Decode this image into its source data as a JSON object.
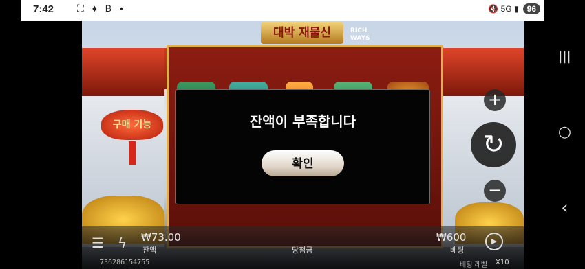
{
  "status_bar": {
    "time": "7:42",
    "left_icons": "⛶ ♦ B •",
    "right_icons": "🔇 5G ▮",
    "battery": "96"
  },
  "nav_bar": {
    "recents_icon": "|||",
    "home_icon": "○",
    "back_icon": "‹"
  },
  "game": {
    "title": "대박 재물신",
    "title_sub_line1": "RICH",
    "title_sub_line2": "WAYS",
    "buy_feature_label": "구매 기능",
    "controls": {
      "plus": "+",
      "spin": "↻",
      "minus": "−"
    },
    "bottom": {
      "menu_icon": "☰",
      "turbo_icon": "ϟ",
      "balance_value": "₩73.00",
      "balance_label": "잔액",
      "win_label": "당첨금",
      "bet_value": "₩600",
      "bet_label": "베팅",
      "autoplay_icon": "▶",
      "session_id": "736286154755",
      "bet_level_label": "베팅 레벨",
      "bet_level_value": "X10"
    }
  },
  "modal": {
    "message": "잔액이 부족합니다",
    "confirm_label": "확인"
  }
}
